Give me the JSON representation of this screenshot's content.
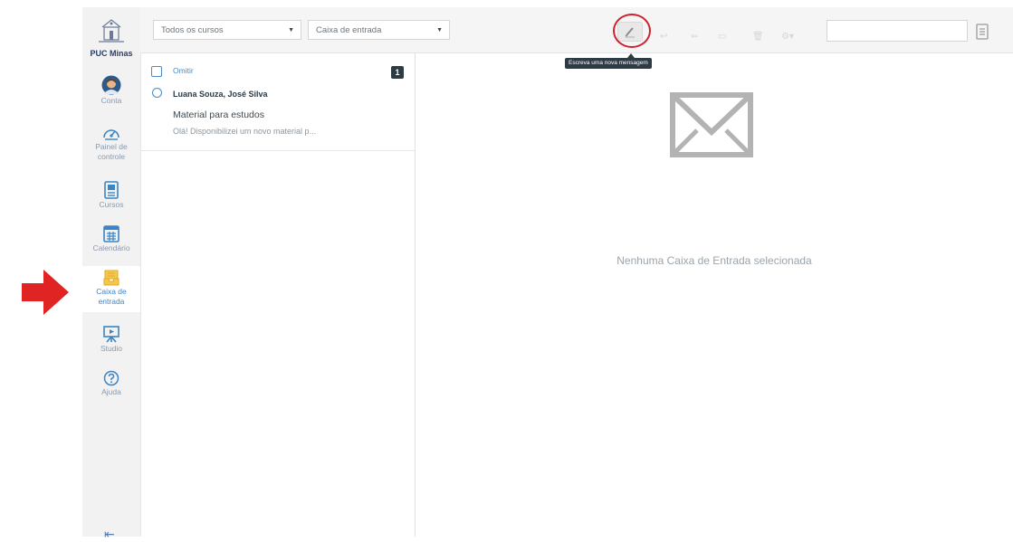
{
  "brand": {
    "logo_text": "PUC Minas"
  },
  "nav": [
    {
      "id": "conta",
      "label": "Conta",
      "icon": "avatar-icon",
      "active": false
    },
    {
      "id": "painel",
      "label": "Painel de controle",
      "icon": "dashboard-icon",
      "active": false
    },
    {
      "id": "cursos",
      "label": "Cursos",
      "icon": "courses-icon",
      "active": false
    },
    {
      "id": "calendario",
      "label": "Calendário",
      "icon": "calendar-icon",
      "active": false
    },
    {
      "id": "caixa",
      "label": "Caixa de entrada",
      "icon": "inbox-icon",
      "active": true
    },
    {
      "id": "studio",
      "label": "Studio",
      "icon": "studio-icon",
      "active": false
    },
    {
      "id": "ajuda",
      "label": "Ajuda",
      "icon": "help-icon",
      "active": false
    }
  ],
  "toolbar": {
    "course_filter": "Todos os cursos",
    "mailbox_filter": "Caixa de entrada",
    "compose_tooltip": "Escreva uma nova mensagem",
    "search_placeholder": ""
  },
  "list": {
    "select_all_label": "Omitir",
    "unread_count": "1",
    "messages": [
      {
        "sender": "Luana Souza, José Silva",
        "subject": "Material para estudos",
        "snippet": "Olá! Disponibilizei um novo material p..."
      }
    ]
  },
  "detail": {
    "empty_message": "Nenhuma Caixa de Entrada selecionada"
  },
  "colors": {
    "accent": "#3a85c6",
    "highlight_ring": "#cc2230",
    "arrow": "#e02424",
    "sidebar_bg": "#f2f2f2"
  }
}
